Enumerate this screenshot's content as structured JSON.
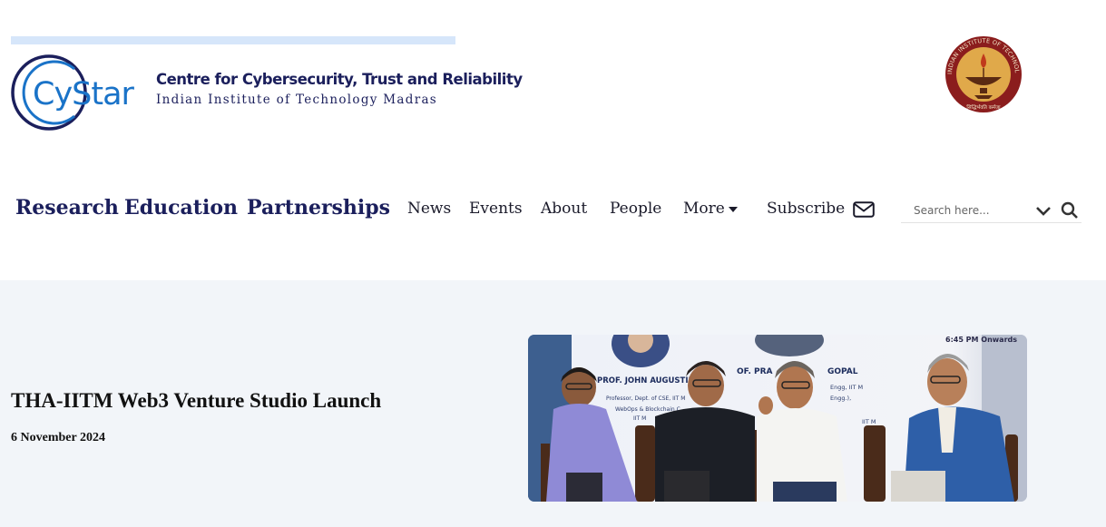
{
  "logo": {
    "mark_text": "CyStar",
    "line1": "Centre for Cybersecurity, Trust and Reliability",
    "line2": "Indian Institute of Technology Madras"
  },
  "seal": {
    "ring_text": "INDIAN INSTITUTE OF TECHNOLOGY MADRAS",
    "motto": "सिद्धिर्भवति कर्मजा"
  },
  "nav": {
    "primary": [
      "Research",
      "Education",
      "Partnerships"
    ],
    "secondary": [
      "News",
      "Events",
      "About",
      "People",
      "More"
    ],
    "subscribe": "Subscribe"
  },
  "search": {
    "placeholder": "Search here..."
  },
  "article": {
    "title": "THA-IITM Web3 Venture Studio Launch",
    "date": "6 November 2024",
    "photo_banner": {
      "time": "6:45 PM Onwards",
      "speaker1_name": "PROF. JOHN AUGUSTINE",
      "speaker1_line1": "Professor, Dept. of CSE, IIT M",
      "speaker1_line2": "WebOps & Blockchain C",
      "speaker1_line3": "IIT M",
      "speaker2_name": "OF. PRA",
      "speaker2_name_end": "GOPAL",
      "speaker2_line1": "Engg, IIT M",
      "speaker2_line2": "Engg.),",
      "speaker2_line3": "IIT M"
    }
  },
  "colors": {
    "brand_navy": "#1b1f5c",
    "brand_blue": "#1a73c8",
    "logo_bar": "#d6e6fa",
    "content_bg": "#f2f5f9",
    "seal_maroon": "#8b1d1d",
    "seal_gold": "#e0a94a"
  },
  "icons": {
    "subscribe": "mail-icon",
    "more": "caret-down-icon",
    "search_toggle": "chevron-down-icon",
    "search": "search-icon"
  }
}
